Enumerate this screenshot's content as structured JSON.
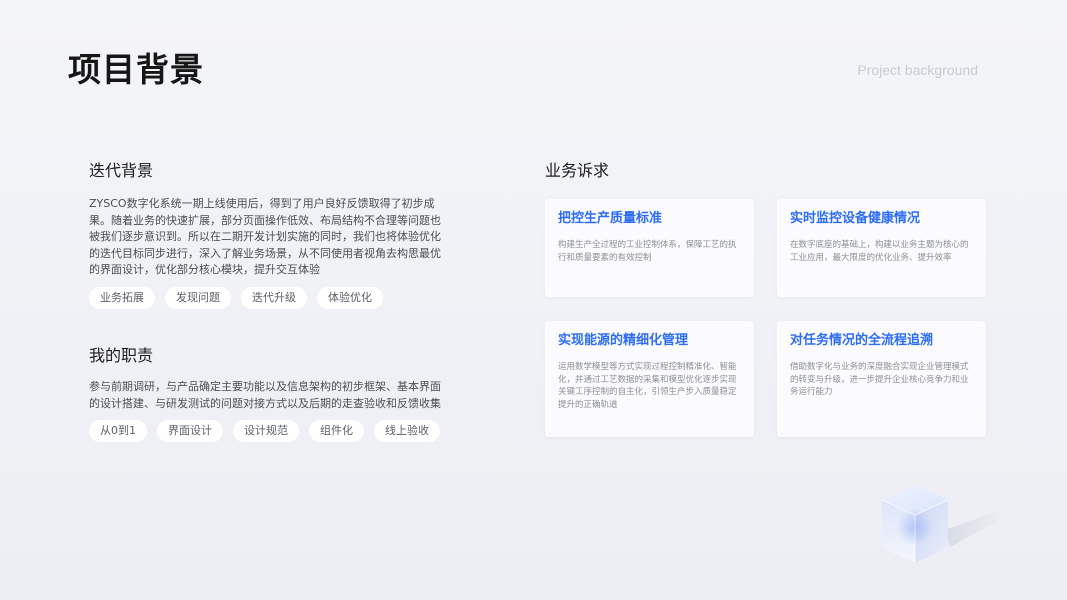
{
  "header": {
    "title": "项目背景",
    "subtitle": "Project background"
  },
  "iteration": {
    "heading": "迭代背景",
    "text": "ZYSCO数字化系统一期上线使用后，得到了用户良好反馈取得了初步成果。随着业务的快速扩展，部分页面操作低效、布局结构不合理等问题也被我们逐步意识到。所以在二期开发计划实施的同时，我们也将体验优化的迭代目标同步进行，深入了解业务场景，从不同使用者视角去构思最优的界面设计，优化部分核心模块，提升交互体验",
    "tags": [
      "业务拓展",
      "发现问题",
      "迭代升级",
      "体验优化"
    ]
  },
  "role": {
    "heading": "我的职责",
    "text": "参与前期调研，与产品确定主要功能以及信息架构的初步框架、基本界面的设计搭建、与研发测试的问题对接方式以及后期的走查验收和反馈收集",
    "tags": [
      "从0到1",
      "界面设计",
      "设计规范",
      "组件化",
      "线上验收"
    ]
  },
  "demands": {
    "heading": "业务诉求",
    "cards": [
      {
        "title": "把控生产质量标准",
        "desc": "构建生产全过程的工业控制体系，保障工艺的执行和质量要素的有效控制"
      },
      {
        "title": "实时监控设备健康情况",
        "desc": "在数字底座的基础上，构建以业务主题为核心的工业应用，最大限度的优化业务、提升效率"
      },
      {
        "title": "实现能源的精细化管理",
        "desc": "运用数学模型等方式实现过程控制精准化、智能化，并通过工艺数据的采集和模型优化逐步实现关键工序控制的自主化，引领生产步入质量稳定提升的正确轨道"
      },
      {
        "title": "对任务情况的全流程追溯",
        "desc": "借助数字化与业务的深度融合实现企业管理模式的转变与升级，进一步提升企业核心竞争力和业务运行能力"
      }
    ]
  },
  "colors": {
    "accent": "#2d6df6",
    "background": "#f1f2f6",
    "card": "#fbfbfd"
  },
  "icons": {
    "decoration": "glass-cube-icon"
  }
}
